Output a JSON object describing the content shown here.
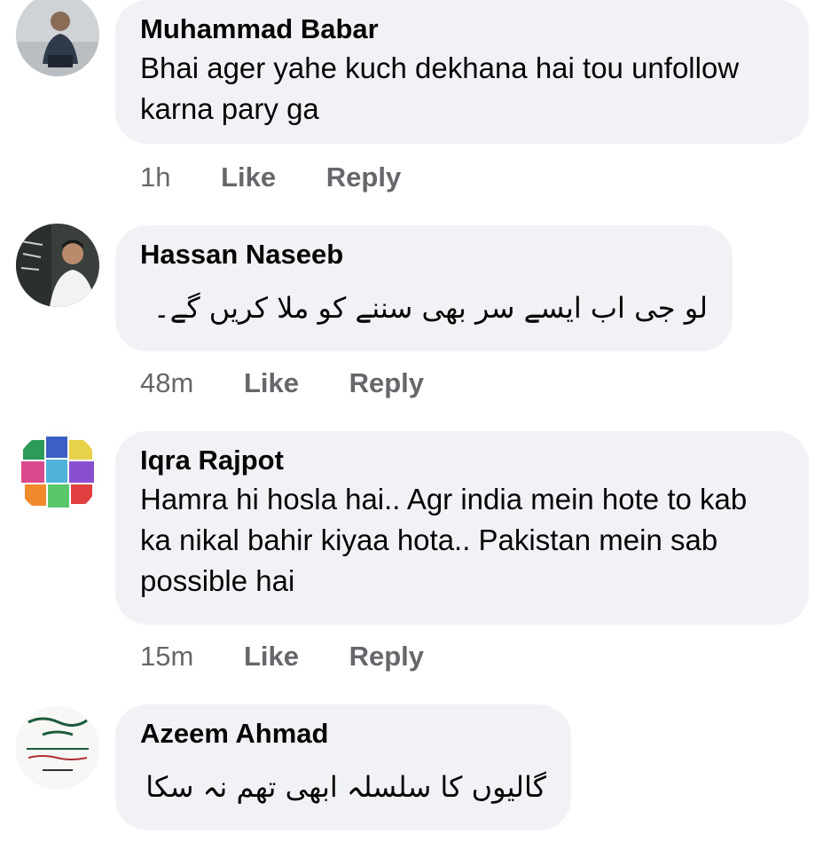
{
  "comments": [
    {
      "author": "Muhammad Babar",
      "text": "Bhai ager yahe kuch dekhana hai tou unfollow karna pary ga",
      "time": "1h",
      "like_label": "Like",
      "reply_label": "Reply"
    },
    {
      "author": "Hassan Naseeb",
      "text": "لو جی اب ایسے سر بھی سننے کو ملا کریں گے۔",
      "time": "48m",
      "like_label": "Like",
      "reply_label": "Reply"
    },
    {
      "author": "Iqra Rajpot",
      "text": "Hamra hi hosla hai.. Agr india mein hote to kab ka nikal bahir kiyaa hota.. Pakistan mein sab possible hai",
      "time": "15m",
      "like_label": "Like",
      "reply_label": "Reply"
    },
    {
      "author": "Azeem Ahmad",
      "text": "گالیوں کا سلسلہ ابھی تھم نہ سکا",
      "time": "",
      "like_label": "",
      "reply_label": ""
    }
  ],
  "colors": {
    "bubble_bg": "#f0f2f5",
    "meta_text": "#65676b",
    "primary_text": "#050505"
  }
}
